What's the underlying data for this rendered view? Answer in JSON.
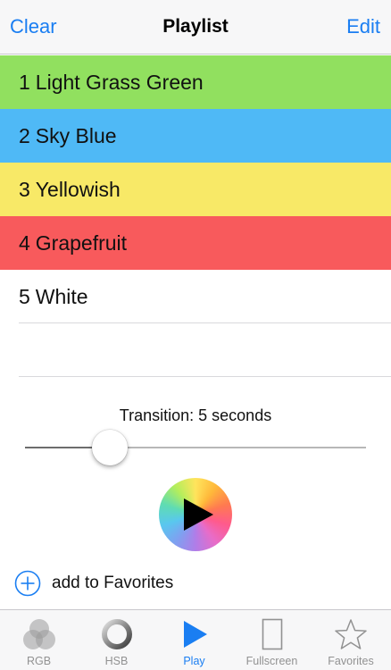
{
  "navbar": {
    "left_label": "Clear",
    "title": "Playlist",
    "right_label": "Edit",
    "accent": "#1a7ef2"
  },
  "playlist": {
    "items": [
      {
        "number": "1",
        "name": "Light Grass Green",
        "color": "#91e05f"
      },
      {
        "number": "2",
        "name": "Sky Blue",
        "color": "#4fb9f6"
      },
      {
        "number": "3",
        "name": "Yellowish",
        "color": "#f8e967"
      },
      {
        "number": "4",
        "name": "Grapefruit",
        "color": "#f85a5c"
      },
      {
        "number": "5",
        "name": "White",
        "color": "#ffffff"
      }
    ]
  },
  "transition": {
    "label": "Transition: 5 seconds",
    "slider_fraction": 0.16
  },
  "play_button": {
    "icon": "play-icon"
  },
  "favorites": {
    "add_label": "add to Favorites",
    "icon": "plus-circle-icon"
  },
  "tabbar": {
    "tabs": [
      {
        "label": "RGB",
        "icon": "rgb-circles-icon",
        "active": false
      },
      {
        "label": "HSB",
        "icon": "hsb-ring-icon",
        "active": false
      },
      {
        "label": "Play",
        "icon": "play-icon",
        "active": true
      },
      {
        "label": "Fullscreen",
        "icon": "fullscreen-icon",
        "active": false
      },
      {
        "label": "Favorites",
        "icon": "star-icon",
        "active": false
      }
    ]
  }
}
